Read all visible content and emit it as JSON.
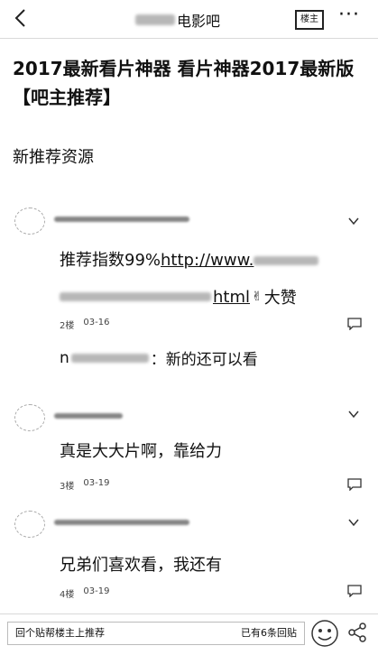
{
  "header": {
    "title": "电影吧",
    "louzhu_label": "楼主",
    "more_label": "···"
  },
  "post": {
    "title": "2017最新看片神器 看片神器2017最新版【吧主推荐】",
    "body": "新推荐资源"
  },
  "replies": [
    {
      "text_prefix": "推荐指数99%",
      "link": "http://www.",
      "link_tail": "html",
      "text_suffix": "大赞",
      "floor": "2楼",
      "date": "03-16",
      "subreply": "：新的还可以看",
      "subreply_initial": "n"
    },
    {
      "text": "真是大大片啊，靠给力",
      "floor": "3楼",
      "date": "03-19"
    },
    {
      "text": "兄弟们喜欢看，我还有",
      "floor": "4楼",
      "date": "03-19"
    }
  ],
  "bottom": {
    "left_label": "回个贴帮楼主上推荐",
    "right_label": "已有6条回贴"
  }
}
